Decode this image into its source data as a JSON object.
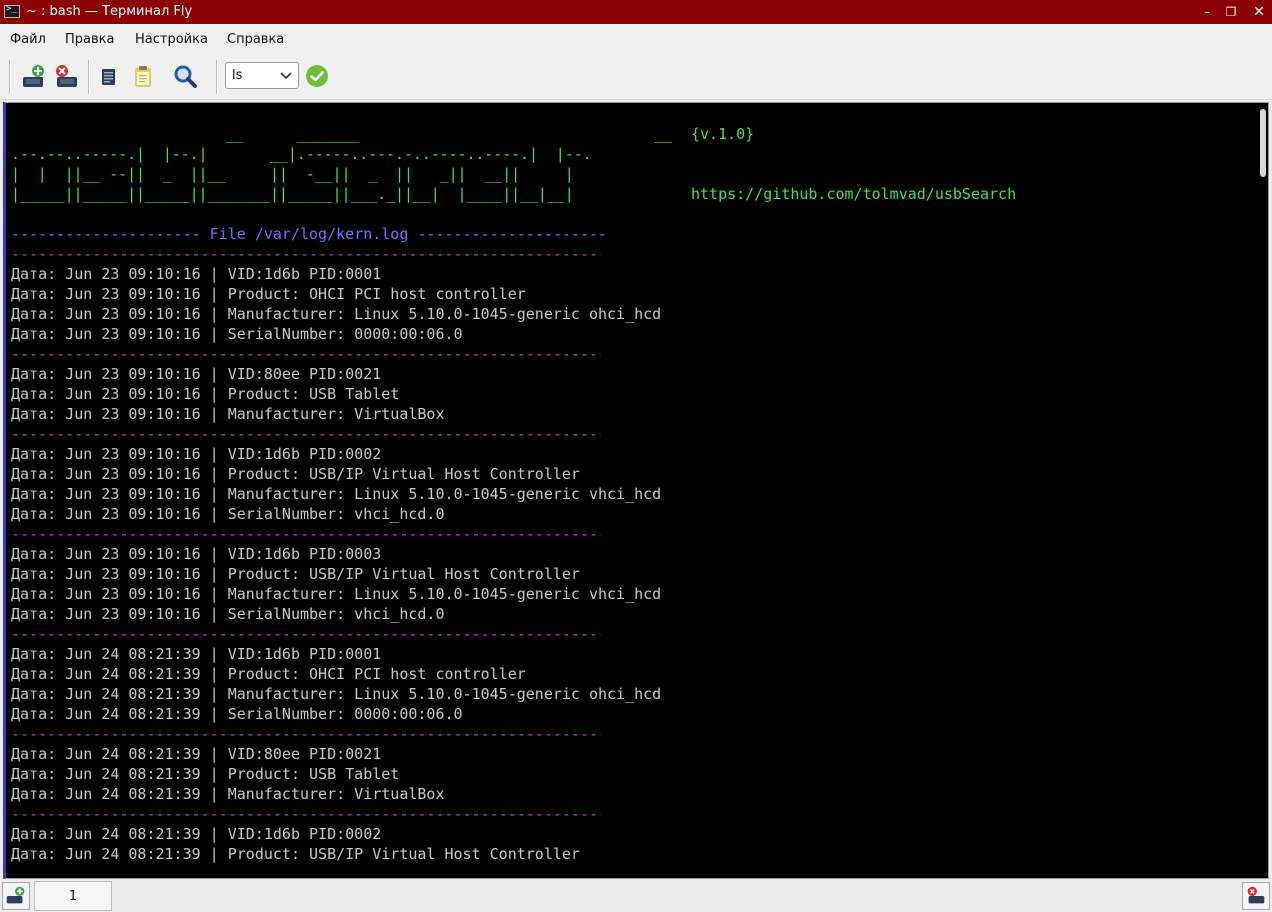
{
  "window": {
    "title": "~ : bash — Терминал Fly"
  },
  "menu": [
    "Файл",
    "Правка",
    "Настройка",
    "Справка"
  ],
  "toolbar": {
    "command_value": "ls"
  },
  "terminal": {
    "ascii_art": [
      "                        __      _______                                 __",
      ".--.--..-----.|  |--.|       __|.-----..---.-..----..----.|  |--.",
      "|  |  ||__ --||  _  ||__     ||  -__||  _  ||   _||  __||     |",
      "|_____||_____||_____||_______||_____||___._||__|  |____||__|__|"
    ],
    "version": "{v.1.0}",
    "url": "https://github.com/tolmvad/usbSearch",
    "file_header": "--------------------- File /var/log/kern.log ---------------------",
    "separator": "-------------------------------------------------------------------------------------------",
    "blocks": [
      [
        "Дата: Jun 23 09:10:16 | VID:1d6b PID:0001",
        "Дата: Jun 23 09:10:16 | Product: OHCI PCI host controller",
        "Дата: Jun 23 09:10:16 | Manufacturer: Linux 5.10.0-1045-generic ohci_hcd",
        "Дата: Jun 23 09:10:16 | SerialNumber: 0000:00:06.0"
      ],
      [
        "Дата: Jun 23 09:10:16 | VID:80ee PID:0021",
        "Дата: Jun 23 09:10:16 | Product: USB Tablet",
        "Дата: Jun 23 09:10:16 | Manufacturer: VirtualBox"
      ],
      [
        "Дата: Jun 23 09:10:16 | VID:1d6b PID:0002",
        "Дата: Jun 23 09:10:16 | Product: USB/IP Virtual Host Controller",
        "Дата: Jun 23 09:10:16 | Manufacturer: Linux 5.10.0-1045-generic vhci_hcd",
        "Дата: Jun 23 09:10:16 | SerialNumber: vhci_hcd.0"
      ],
      [
        "Дата: Jun 23 09:10:16 | VID:1d6b PID:0003",
        "Дата: Jun 23 09:10:16 | Product: USB/IP Virtual Host Controller",
        "Дата: Jun 23 09:10:16 | Manufacturer: Linux 5.10.0-1045-generic vhci_hcd",
        "Дата: Jun 23 09:10:16 | SerialNumber: vhci_hcd.0"
      ],
      [
        "Дата: Jun 24 08:21:39 | VID:1d6b PID:0001",
        "Дата: Jun 24 08:21:39 | Product: OHCI PCI host controller",
        "Дата: Jun 24 08:21:39 | Manufacturer: Linux 5.10.0-1045-generic ohci_hcd",
        "Дата: Jun 24 08:21:39 | SerialNumber: 0000:00:06.0"
      ],
      [
        "Дата: Jun 24 08:21:39 | VID:80ee PID:0021",
        "Дата: Jun 24 08:21:39 | Product: USB Tablet",
        "Дата: Jun 24 08:21:39 | Manufacturer: VirtualBox"
      ],
      [
        "Дата: Jun 24 08:21:39 | VID:1d6b PID:0002",
        "Дата: Jun 24 08:21:39 | Product: USB/IP Virtual Host Controller"
      ]
    ]
  },
  "tabs": [
    {
      "label": "1"
    }
  ]
}
